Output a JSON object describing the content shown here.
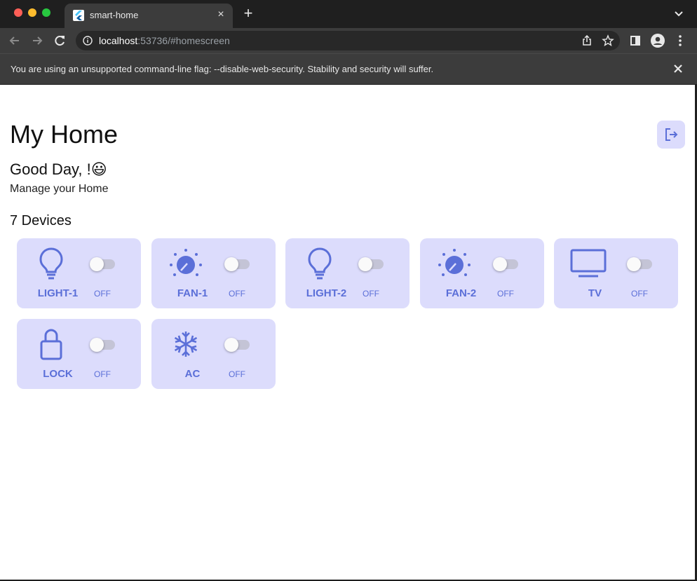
{
  "browser": {
    "tab_title": "smart-home",
    "new_tab_label": "+",
    "tab_close_label": "×",
    "url_host": "localhost",
    "url_rest": ":53736/#homescreen",
    "infobar_text": "You are using an unsupported command-line flag: --disable-web-security. Stability and security will suffer."
  },
  "app": {
    "title": "My Home",
    "greeting": "Good Day, !😃",
    "subtitle": "Manage your Home",
    "device_count": "7 Devices",
    "accent_color": "#5b6fd8",
    "card_color": "#dcdcfc"
  },
  "devices": [
    {
      "name": "LIGHT-1",
      "status": "OFF",
      "icon": "lightbulb-icon",
      "on": false
    },
    {
      "name": "FAN-1",
      "status": "OFF",
      "icon": "fan-dial-icon",
      "on": false
    },
    {
      "name": "LIGHT-2",
      "status": "OFF",
      "icon": "lightbulb-icon",
      "on": false
    },
    {
      "name": "FAN-2",
      "status": "OFF",
      "icon": "fan-dial-icon",
      "on": false
    },
    {
      "name": "TV",
      "status": "OFF",
      "icon": "tv-icon",
      "on": false
    },
    {
      "name": "LOCK",
      "status": "OFF",
      "icon": "lock-icon",
      "on": false
    },
    {
      "name": "AC",
      "status": "OFF",
      "icon": "snowflake-icon",
      "on": false
    }
  ]
}
